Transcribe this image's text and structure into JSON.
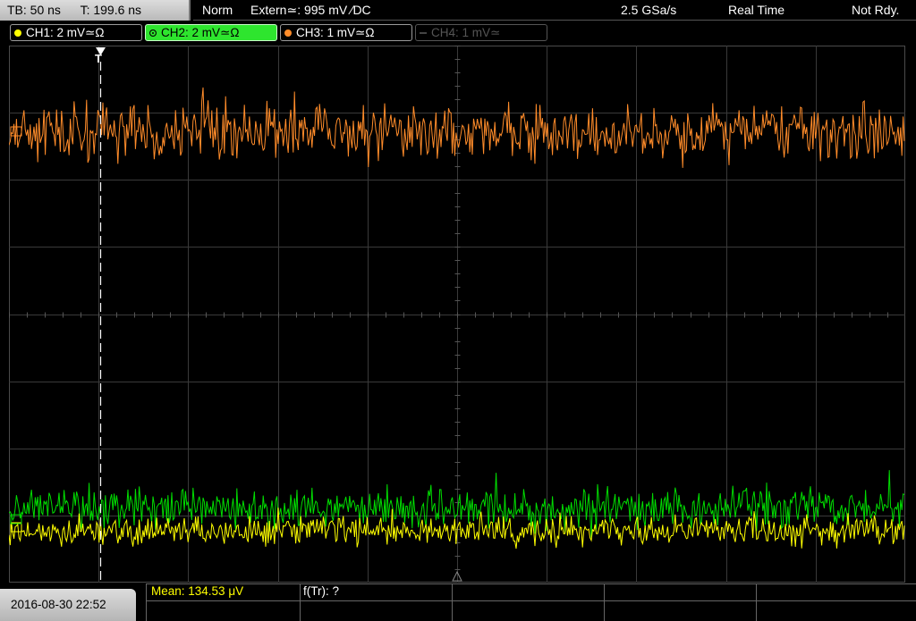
{
  "status": {
    "timebase": "TB: 50 ns",
    "trigger_time": "T: 199.6 ns",
    "mode": "Norm",
    "trigger_source": "Extern≃: 995 mV ∕DC",
    "sample_rate": "2.5 GSa/s",
    "acq_mode": "Real Time",
    "state": "Not Rdy."
  },
  "channels": [
    {
      "label": "CH1: 2 mV≃Ω",
      "color": "#ffff00",
      "active": false,
      "enabled": true
    },
    {
      "label": "CH2: 2 mV≃Ω",
      "color": "#00dd00",
      "active": true,
      "enabled": true
    },
    {
      "label": "CH3: 1 mV≃Ω",
      "color": "#ff8c2a",
      "active": false,
      "enabled": true
    },
    {
      "label": "CH4: 1 mV≃",
      "color": "#555555",
      "active": false,
      "enabled": false
    }
  ],
  "trigger_marker": "T",
  "datetime": "2016-08-30 22:52",
  "measurements": {
    "mean": "Mean: 134.53 μV",
    "freq": "f(Tr): ?"
  },
  "colors": {
    "ch1": "#ffff00",
    "ch2": "#00dd00",
    "ch3": "#ff8c2a",
    "grid": "#3a3a3a",
    "background": "#000000"
  }
}
